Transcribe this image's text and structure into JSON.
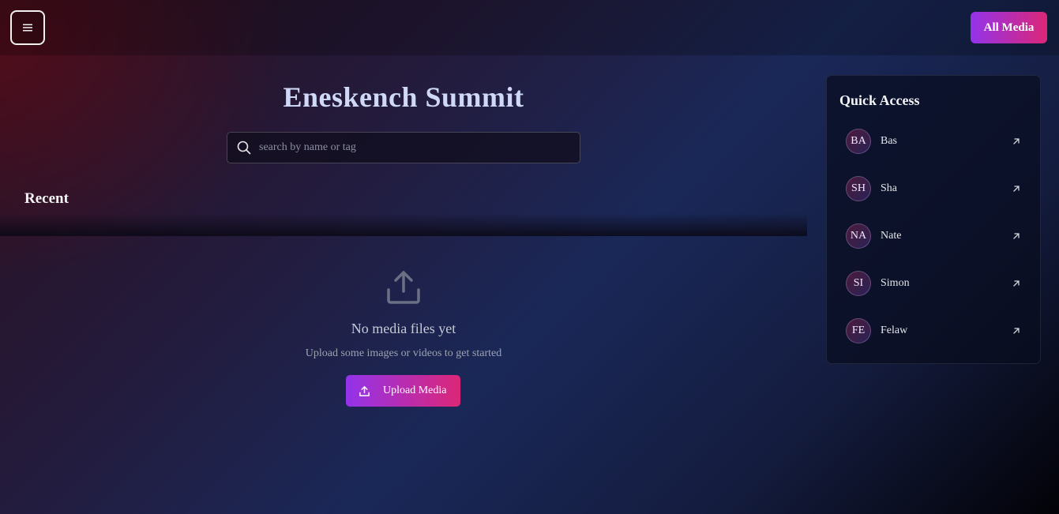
{
  "header": {
    "menu_icon": "hamburger-menu-icon",
    "all_media_label": "All Media"
  },
  "main": {
    "title": "Eneskench Summit",
    "search_placeholder": "search by name or tag",
    "recent_heading": "Recent",
    "empty_state": {
      "icon": "upload-icon",
      "title": "No media files yet",
      "subtitle": "Upload some images or videos to get started",
      "button_label": "Upload Media"
    }
  },
  "quick_access": {
    "title": "Quick Access",
    "items": [
      {
        "initials": "BA",
        "name": "Bas"
      },
      {
        "initials": "SH",
        "name": "Sha"
      },
      {
        "initials": "NA",
        "name": "Nate"
      },
      {
        "initials": "SI",
        "name": "Simon"
      },
      {
        "initials": "FE",
        "name": "Felaw"
      }
    ]
  },
  "colors": {
    "accent_start": "#9333ea",
    "accent_end": "#db2777",
    "title": "#cfd8f7"
  }
}
